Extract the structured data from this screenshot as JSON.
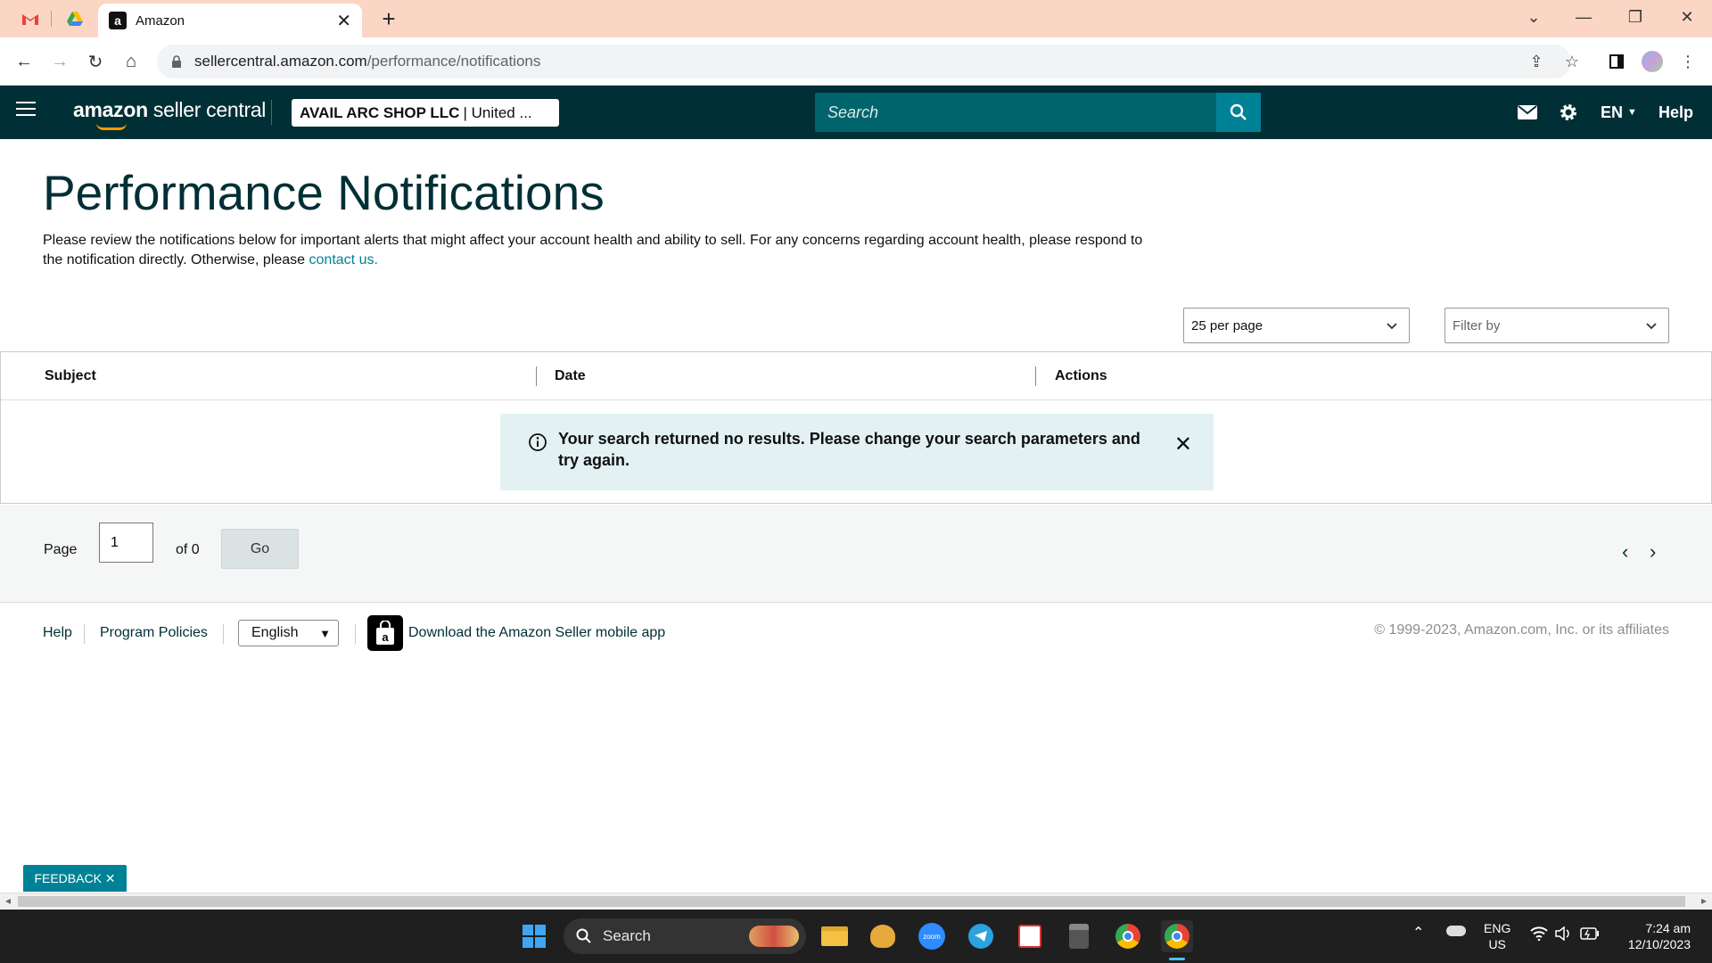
{
  "browser": {
    "tab_title": "Amazon",
    "url_host": "sellercentral.amazon.com",
    "url_path": "/performance/notifications"
  },
  "header": {
    "logo_bold": "amazon",
    "logo_rest": " seller central",
    "account_name": "AVAIL ARC SHOP LLC",
    "account_region": "| United ...",
    "search_placeholder": "Search",
    "language": "EN",
    "help": "Help"
  },
  "page": {
    "title": "Performance Notifications",
    "description": "Please review the notifications below for important alerts that might affect your account health and ability to sell. For any concerns regarding account health, please respond to the notification directly. Otherwise, please",
    "contact_link": "contact us."
  },
  "filters": {
    "per_page": "25 per page",
    "filter_by": "Filter by"
  },
  "table": {
    "columns": [
      "Subject",
      "Date",
      "Actions"
    ],
    "empty_message": "Your search returned no results. Please change your search parameters and try again."
  },
  "pager": {
    "page_label": "Page",
    "page_value": "1",
    "of_label": "of 0",
    "go_label": "Go"
  },
  "footer": {
    "help": "Help",
    "program_policies": "Program Policies",
    "language": "English",
    "app_text": "Download the Amazon Seller mobile app",
    "copyright": "© 1999-2023, Amazon.com, Inc. or its affiliates"
  },
  "feedback_label": "FEEDBACK ✕",
  "taskbar": {
    "search": "Search",
    "lang_top": "ENG",
    "lang_bottom": "US",
    "time": "7:24 am",
    "date": "12/10/2023"
  }
}
